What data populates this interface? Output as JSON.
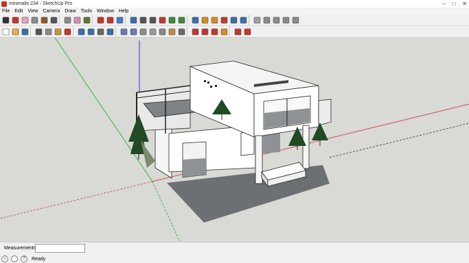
{
  "window": {
    "title": "minimalis 234 - SketchUp Pro",
    "min_glyph": "–",
    "max_glyph": "□",
    "close_glyph": "✕"
  },
  "menu": [
    "File",
    "Edit",
    "View",
    "Camera",
    "Draw",
    "Tools",
    "Window",
    "Help"
  ],
  "toolbar_row1": [
    {
      "name": "select-icon",
      "color": "#333333"
    },
    {
      "name": "line-icon",
      "color": "#c0392b"
    },
    {
      "name": "eraser-icon",
      "color": "#e8a2b5"
    },
    {
      "name": "rectangle-icon",
      "color": "#8a8a8a"
    },
    {
      "name": "circle-icon",
      "color": "#8b5a2b"
    },
    {
      "name": "arc-icon",
      "color": "#555555"
    },
    {
      "name": "push-pull-icon",
      "color": "#8a8a8a"
    },
    {
      "name": "paint-bucket-icon",
      "color": "#d98cb3"
    },
    {
      "name": "dimension-icon",
      "color": "#5a7a2a"
    },
    {
      "name": "move-icon",
      "color": "#c0392b"
    },
    {
      "name": "rotate-icon",
      "color": "#c0392b"
    },
    {
      "name": "follow-me-icon",
      "color": "#4a7ac8"
    },
    {
      "name": "orbit-icon",
      "color": "#3a6ea8"
    },
    {
      "name": "zoom-icon",
      "color": "#555555"
    },
    {
      "name": "zoom-window-icon",
      "color": "#555555"
    },
    {
      "name": "zoom-extents-icon",
      "color": "#c0392b"
    },
    {
      "name": "previous-view-icon",
      "color": "#3a8a3a"
    },
    {
      "name": "next-view-icon",
      "color": "#3a8a3a"
    },
    {
      "name": "camera-icon",
      "color": "#3a6ea8"
    },
    {
      "name": "get-models-icon",
      "color": "#d98a1e"
    },
    {
      "name": "share-model-icon",
      "color": "#d98a1e"
    },
    {
      "name": "components-icon",
      "color": "#c0392b"
    },
    {
      "name": "photo-textures-icon",
      "color": "#3a6ea8"
    },
    {
      "name": "preview-google-earth-icon",
      "color": "#3a6ea8"
    },
    {
      "name": "house-view-icon",
      "color": "#a0a0a0"
    },
    {
      "name": "iso-view-icon",
      "color": "#8a8a8a"
    },
    {
      "name": "top-view-icon",
      "color": "#8a8a8a"
    },
    {
      "name": "front-view-icon",
      "color": "#8a8a8a"
    },
    {
      "name": "right-view-icon",
      "color": "#8a8a8a"
    }
  ],
  "toolbar_row2": [
    {
      "name": "new-file-icon",
      "color": "#ffffff"
    },
    {
      "name": "open-file-icon",
      "color": "#e0b040"
    },
    {
      "name": "save-icon",
      "color": "#3a6ea8"
    },
    {
      "name": "cut-icon",
      "color": "#555555"
    },
    {
      "name": "copy-icon",
      "color": "#8a8a8a"
    },
    {
      "name": "paste-icon",
      "color": "#c09a40"
    },
    {
      "name": "erase-selection-icon",
      "color": "#c0392b"
    },
    {
      "name": "undo-icon",
      "color": "#3a6ea8"
    },
    {
      "name": "redo-icon",
      "color": "#3a6ea8"
    },
    {
      "name": "print-icon",
      "color": "#666666"
    },
    {
      "name": "model-info-icon",
      "color": "#3a6ea8"
    },
    {
      "name": "xray-style-icon",
      "color": "#6a7ab8"
    },
    {
      "name": "back-edges-style-icon",
      "color": "#6a7ab8"
    },
    {
      "name": "wireframe-style-icon",
      "color": "#8a8a8a"
    },
    {
      "name": "hidden-line-style-icon",
      "color": "#9a9a9a"
    },
    {
      "name": "shaded-style-icon",
      "color": "#8a8a8a"
    },
    {
      "name": "shaded-textures-style-icon",
      "color": "#c08a40"
    },
    {
      "name": "monochrome-style-icon",
      "color": "#6a6a6a"
    },
    {
      "name": "add-location-icon",
      "color": "#c0392b"
    },
    {
      "name": "toggle-terrain-icon",
      "color": "#c0392b"
    },
    {
      "name": "section-plane-icon",
      "color": "#c0392b"
    },
    {
      "name": "display-sections-icon",
      "color": "#d98a1e"
    },
    {
      "name": "walk-icon",
      "color": "#c0392b"
    },
    {
      "name": "look-around-icon",
      "color": "#c0392b"
    }
  ],
  "colors": {
    "sky": "#d9d9d6",
    "ground": "#d6d6d3",
    "axis_red": "#d04848",
    "axis_green": "#3cb43c",
    "axis_blue": "#2a3ed0",
    "wall": "#ffffff",
    "shade": "#8e9294",
    "shadow": "#6d7072",
    "tree": "#1f4a24"
  },
  "status": {
    "measurements_label": "Measurements",
    "measurements_value": "",
    "ready_text": "Ready",
    "icon_info": "i",
    "icon_help": "?"
  }
}
